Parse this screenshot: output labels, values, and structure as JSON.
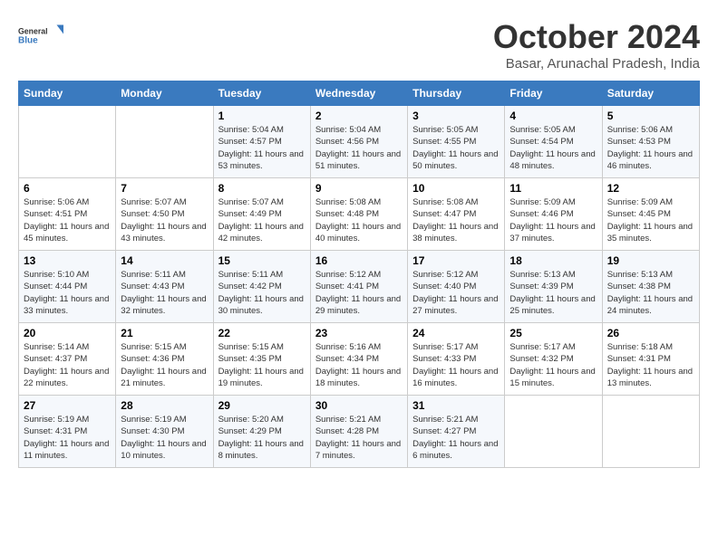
{
  "header": {
    "logo": {
      "line1": "General",
      "line2": "Blue"
    },
    "title": "October 2024",
    "location": "Basar, Arunachal Pradesh, India"
  },
  "days_of_week": [
    "Sunday",
    "Monday",
    "Tuesday",
    "Wednesday",
    "Thursday",
    "Friday",
    "Saturday"
  ],
  "weeks": [
    [
      {
        "day": "",
        "info": ""
      },
      {
        "day": "",
        "info": ""
      },
      {
        "day": "1",
        "info": "Sunrise: 5:04 AM\nSunset: 4:57 PM\nDaylight: 11 hours and 53 minutes."
      },
      {
        "day": "2",
        "info": "Sunrise: 5:04 AM\nSunset: 4:56 PM\nDaylight: 11 hours and 51 minutes."
      },
      {
        "day": "3",
        "info": "Sunrise: 5:05 AM\nSunset: 4:55 PM\nDaylight: 11 hours and 50 minutes."
      },
      {
        "day": "4",
        "info": "Sunrise: 5:05 AM\nSunset: 4:54 PM\nDaylight: 11 hours and 48 minutes."
      },
      {
        "day": "5",
        "info": "Sunrise: 5:06 AM\nSunset: 4:53 PM\nDaylight: 11 hours and 46 minutes."
      }
    ],
    [
      {
        "day": "6",
        "info": "Sunrise: 5:06 AM\nSunset: 4:51 PM\nDaylight: 11 hours and 45 minutes."
      },
      {
        "day": "7",
        "info": "Sunrise: 5:07 AM\nSunset: 4:50 PM\nDaylight: 11 hours and 43 minutes."
      },
      {
        "day": "8",
        "info": "Sunrise: 5:07 AM\nSunset: 4:49 PM\nDaylight: 11 hours and 42 minutes."
      },
      {
        "day": "9",
        "info": "Sunrise: 5:08 AM\nSunset: 4:48 PM\nDaylight: 11 hours and 40 minutes."
      },
      {
        "day": "10",
        "info": "Sunrise: 5:08 AM\nSunset: 4:47 PM\nDaylight: 11 hours and 38 minutes."
      },
      {
        "day": "11",
        "info": "Sunrise: 5:09 AM\nSunset: 4:46 PM\nDaylight: 11 hours and 37 minutes."
      },
      {
        "day": "12",
        "info": "Sunrise: 5:09 AM\nSunset: 4:45 PM\nDaylight: 11 hours and 35 minutes."
      }
    ],
    [
      {
        "day": "13",
        "info": "Sunrise: 5:10 AM\nSunset: 4:44 PM\nDaylight: 11 hours and 33 minutes."
      },
      {
        "day": "14",
        "info": "Sunrise: 5:11 AM\nSunset: 4:43 PM\nDaylight: 11 hours and 32 minutes."
      },
      {
        "day": "15",
        "info": "Sunrise: 5:11 AM\nSunset: 4:42 PM\nDaylight: 11 hours and 30 minutes."
      },
      {
        "day": "16",
        "info": "Sunrise: 5:12 AM\nSunset: 4:41 PM\nDaylight: 11 hours and 29 minutes."
      },
      {
        "day": "17",
        "info": "Sunrise: 5:12 AM\nSunset: 4:40 PM\nDaylight: 11 hours and 27 minutes."
      },
      {
        "day": "18",
        "info": "Sunrise: 5:13 AM\nSunset: 4:39 PM\nDaylight: 11 hours and 25 minutes."
      },
      {
        "day": "19",
        "info": "Sunrise: 5:13 AM\nSunset: 4:38 PM\nDaylight: 11 hours and 24 minutes."
      }
    ],
    [
      {
        "day": "20",
        "info": "Sunrise: 5:14 AM\nSunset: 4:37 PM\nDaylight: 11 hours and 22 minutes."
      },
      {
        "day": "21",
        "info": "Sunrise: 5:15 AM\nSunset: 4:36 PM\nDaylight: 11 hours and 21 minutes."
      },
      {
        "day": "22",
        "info": "Sunrise: 5:15 AM\nSunset: 4:35 PM\nDaylight: 11 hours and 19 minutes."
      },
      {
        "day": "23",
        "info": "Sunrise: 5:16 AM\nSunset: 4:34 PM\nDaylight: 11 hours and 18 minutes."
      },
      {
        "day": "24",
        "info": "Sunrise: 5:17 AM\nSunset: 4:33 PM\nDaylight: 11 hours and 16 minutes."
      },
      {
        "day": "25",
        "info": "Sunrise: 5:17 AM\nSunset: 4:32 PM\nDaylight: 11 hours and 15 minutes."
      },
      {
        "day": "26",
        "info": "Sunrise: 5:18 AM\nSunset: 4:31 PM\nDaylight: 11 hours and 13 minutes."
      }
    ],
    [
      {
        "day": "27",
        "info": "Sunrise: 5:19 AM\nSunset: 4:31 PM\nDaylight: 11 hours and 11 minutes."
      },
      {
        "day": "28",
        "info": "Sunrise: 5:19 AM\nSunset: 4:30 PM\nDaylight: 11 hours and 10 minutes."
      },
      {
        "day": "29",
        "info": "Sunrise: 5:20 AM\nSunset: 4:29 PM\nDaylight: 11 hours and 8 minutes."
      },
      {
        "day": "30",
        "info": "Sunrise: 5:21 AM\nSunset: 4:28 PM\nDaylight: 11 hours and 7 minutes."
      },
      {
        "day": "31",
        "info": "Sunrise: 5:21 AM\nSunset: 4:27 PM\nDaylight: 11 hours and 6 minutes."
      },
      {
        "day": "",
        "info": ""
      },
      {
        "day": "",
        "info": ""
      }
    ]
  ]
}
